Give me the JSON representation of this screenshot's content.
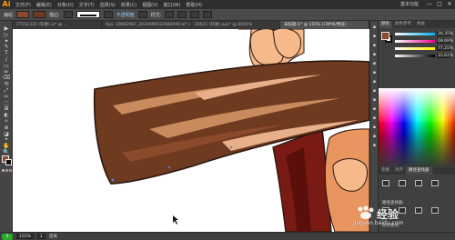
{
  "app": {
    "logo": "Ai",
    "workspace": "基本功能"
  },
  "menu": [
    "文件(F)",
    "编辑(E)",
    "对象(O)",
    "文字(T)",
    "选择(S)",
    "效果(C)",
    "视图(V)",
    "窗口(W)",
    "帮助(H)"
  ],
  "window_controls": [
    "—",
    "□",
    "✕"
  ],
  "control": {
    "object_label": "编组",
    "stroke_label": "描边:",
    "opacity_label": "不透明度",
    "style_label": "样式:",
    "fill_color": "#8a4a2b",
    "stroke_color": "#6e3a20"
  },
  "tabs": [
    {
      "label": "1T1S1335 (轮廓).ai* @ ...",
      "active": false
    },
    {
      "label": "Kyp: 29842967_2019090182080090.ai* @ ...",
      "active": false
    },
    {
      "label": "20621 (轮廓).eps* @ 6654%",
      "active": false
    },
    {
      "label": "未标题-1* @ 155% (CMYK/预览)",
      "active": true
    }
  ],
  "tools": [
    "▶",
    "▷",
    "✦",
    "✎",
    "T",
    "/",
    "▭",
    "✏",
    "⌫",
    "⟲",
    "⤢",
    "✂",
    "⬚",
    "⊞",
    "◐",
    "✧",
    "⊕",
    "◪",
    "⌖",
    "✋",
    "🔍"
  ],
  "colors": {
    "wood_dark": "#6e3a20",
    "wood_mid": "#8a4a2b",
    "wood_light": "#c98a5e",
    "wood_highlight": "#e8b08a",
    "handle_red": "#7a1a14",
    "skin": "#f6b98a",
    "skin_dark": "#e8955f",
    "outline": "#2a1710"
  },
  "right_panel": {
    "color_tabs": [
      "颜色",
      "颜色参考",
      "色板"
    ],
    "sliders": [
      {
        "label": "C",
        "value": "26.35%"
      },
      {
        "label": "M",
        "value": "69.69%"
      },
      {
        "label": "Y",
        "value": "77.25%"
      },
      {
        "label": "K",
        "value": "15.61%"
      }
    ],
    "sub_tabs": [
      "变换",
      "对齐",
      "路径查找器"
    ],
    "shape_modes_label": "形状模式:",
    "pathfinder_label": "路径查找器:",
    "expand_label": "扩展"
  },
  "status": {
    "zoom": "155%",
    "page": "1",
    "tool_name": "选择",
    "badge": "S"
  },
  "watermark": {
    "name": "经验",
    "url": "jingyan.baidu.com"
  }
}
